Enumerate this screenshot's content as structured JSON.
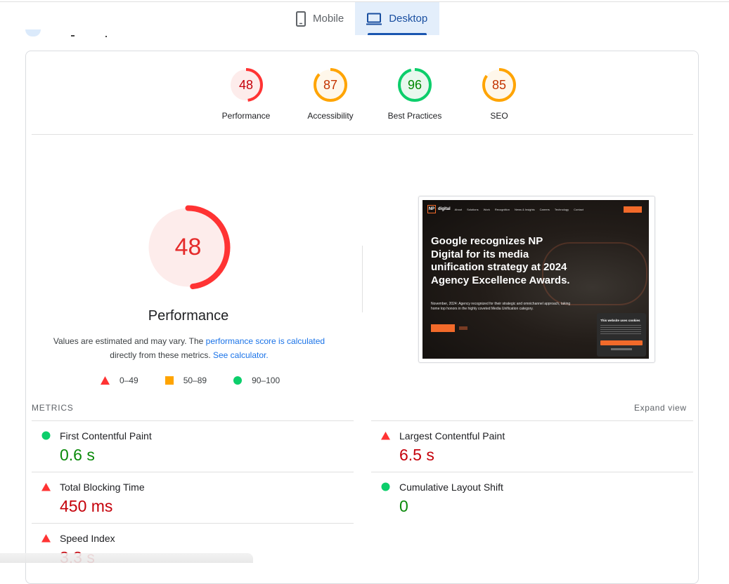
{
  "tabs": [
    {
      "label": "Mobile",
      "icon": "smartphone-icon",
      "active": false
    },
    {
      "label": "Desktop",
      "icon": "laptop-icon",
      "active": true
    }
  ],
  "categories": [
    {
      "label": "Performance",
      "score": 48,
      "rating": "fail",
      "color": "#ff3333",
      "text_color": "#c5000a",
      "bg": "#fdeceb"
    },
    {
      "label": "Accessibility",
      "score": 87,
      "rating": "average",
      "color": "#ffa400",
      "text_color": "#c33300",
      "bg": "#fff7ea"
    },
    {
      "label": "Best Practices",
      "score": 96,
      "rating": "pass",
      "color": "#0cce6b",
      "text_color": "#008800",
      "bg": "#e8f8ee"
    },
    {
      "label": "SEO",
      "score": 85,
      "rating": "average",
      "color": "#ffa400",
      "text_color": "#c33300",
      "bg": "#fff7ea"
    }
  ],
  "performance": {
    "score": 48,
    "title": "Performance",
    "desc_prefix": "Values are estimated and may vary. The ",
    "desc_link1": "performance score is calculated",
    "desc_middle": " directly from these metrics. ",
    "desc_link2": "See calculator."
  },
  "legend": [
    {
      "range": "0–49",
      "shape": "triangle",
      "color": "#ff3333"
    },
    {
      "range": "50–89",
      "shape": "square",
      "color": "#ffa400"
    },
    {
      "range": "90–100",
      "shape": "circle",
      "color": "#0cce6b"
    }
  ],
  "screenshot": {
    "brand": "NP",
    "brand_text": "digital",
    "nav_links": [
      "About",
      "Solutions",
      "Work",
      "Recognition",
      "News & Insights",
      "Careers",
      "Technology",
      "Contact"
    ],
    "headline": "Google recognizes NP Digital for its media unification strategy at 2024 Agency Excellence Awards.",
    "subtext": "November, 2024: Agency recognized for their strategic and omnichannel approach, taking home top honors in the highly coveted Media Unification category.",
    "cookie_title": "This website uses cookies",
    "cookie_button": "ACCEPT ALL",
    "cookie_details": "SHOW DETAILS"
  },
  "metrics": {
    "label": "METRICS",
    "expand_label": "Expand view",
    "items": [
      {
        "name": "First Contentful Paint",
        "value": "0.6 s",
        "rating": "pass"
      },
      {
        "name": "Largest Contentful Paint",
        "value": "6.5 s",
        "rating": "fail"
      },
      {
        "name": "Total Blocking Time",
        "value": "450 ms",
        "rating": "fail"
      },
      {
        "name": "Cumulative Layout Shift",
        "value": "0",
        "rating": "pass"
      },
      {
        "name": "Speed Index",
        "value": "3.3 s",
        "rating": "fail"
      }
    ]
  }
}
